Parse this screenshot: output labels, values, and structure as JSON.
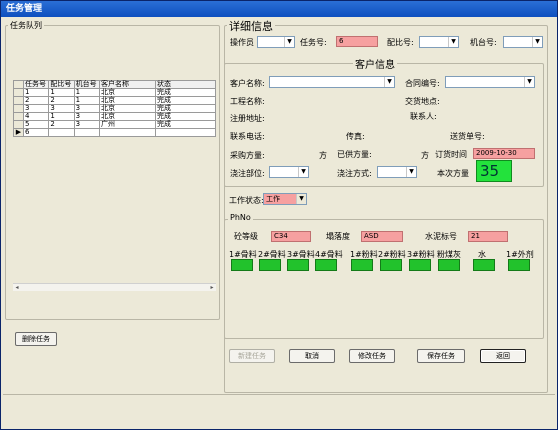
{
  "window": {
    "title": "任务管理"
  },
  "queue": {
    "legend": "任务队列",
    "headers": [
      "任务号",
      "配比号",
      "机台号",
      "客户名称",
      "状态"
    ],
    "rows": [
      [
        "1",
        "1",
        "1",
        "北京",
        "完成"
      ],
      [
        "2",
        "2",
        "1",
        "北京",
        "完成"
      ],
      [
        "3",
        "3",
        "3",
        "北京",
        "完成"
      ],
      [
        "4",
        "1",
        "3",
        "北京",
        "完成"
      ],
      [
        "5",
        "2",
        "3",
        "广州",
        "完成"
      ],
      [
        "6",
        "",
        "",
        "",
        ""
      ]
    ],
    "current_row_marker": "▶",
    "delete_button": "删除任务"
  },
  "detail": {
    "title": "详细信息",
    "operator_label": "操作员",
    "task_no_label": "任务号:",
    "task_no_value": "6",
    "mix_no_label": "配比号:",
    "machine_no_label": "机台号:"
  },
  "customer": {
    "legend": "客户信息",
    "name_label": "客户名称:",
    "contract_label": "合同编号:",
    "project_label": "工程名称:",
    "delivery_place_label": "交货地点:",
    "address_label": "注册地址:",
    "contact_label": "联系人:",
    "phone_label": "联系电话:",
    "fax_label": "传真:",
    "ship_no_label": "送货单号:",
    "purchase_label": "采购方量:",
    "unit1": "方",
    "supplied_label": "已供方量:",
    "unit2": "方",
    "order_time_label": "订货时间",
    "order_time_value": "2009-10-30",
    "pour_part_label": "浇注部位:",
    "pour_method_label": "浇注方式:",
    "current_volume_label": "本次方量",
    "current_volume_value": "35"
  },
  "work_state": {
    "label": "工作状态:",
    "value": "工作"
  },
  "ph": {
    "legend": "PhNo",
    "grade_label": "砼等级",
    "grade_value": "C34",
    "slump_label": "塌落度",
    "slump_value": "ASD",
    "cement_label": "水泥标号",
    "cement_value": "21",
    "materials": [
      "1#骨料",
      "2#骨料",
      "3#骨料",
      "4#骨料",
      "1#粉料",
      "2#粉料",
      "3#粉料",
      "粉煤灰",
      "水",
      "1#外剂"
    ]
  },
  "actions": {
    "new_task": "新建任务",
    "cancel": "取消",
    "modify_task": "修改任务",
    "save_task": "保存任务",
    "back": "返回"
  },
  "colors": {
    "titlebar": "#0d4fbf",
    "field_pink": "#f6a0a0",
    "indicator_green": "#22c22c",
    "window_bg": "#ece9d8"
  }
}
